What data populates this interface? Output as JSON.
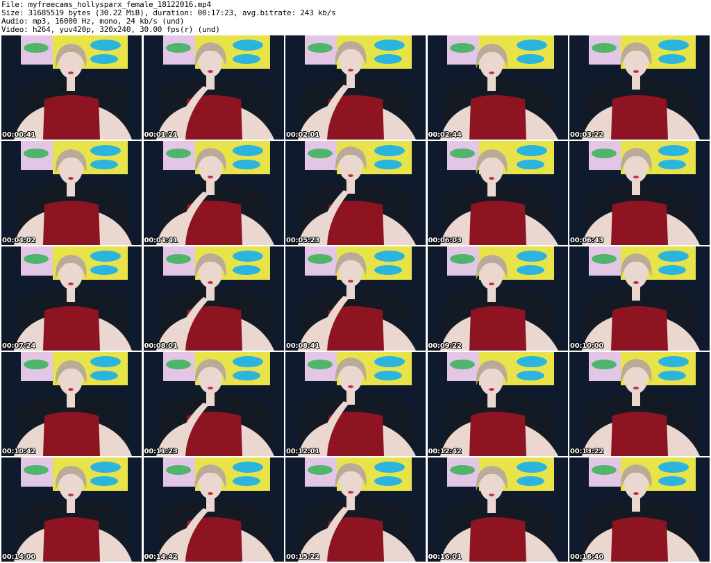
{
  "header": {
    "file_line": "File: myfreecams_hollysparx_female_18122016.mp4",
    "size_line": "Size: 31685519 bytes (30.22 MiB), duration: 00:17:23, avg.bitrate: 243 kb/s",
    "audio_line": "Audio: mp3, 16000 Hz, mono, 24 kb/s (und)",
    "video_line": "Video: h264, yuv420p, 320x240, 30.00 fps(r) (und)"
  },
  "thumbnails": [
    {
      "timestamp": "00:00:41"
    },
    {
      "timestamp": "00:01:21"
    },
    {
      "timestamp": "00:02:01"
    },
    {
      "timestamp": "00:02:44"
    },
    {
      "timestamp": "00:03:22"
    },
    {
      "timestamp": "00:04:02"
    },
    {
      "timestamp": "00:04:41"
    },
    {
      "timestamp": "00:05:23"
    },
    {
      "timestamp": "00:06:03"
    },
    {
      "timestamp": "00:06:43"
    },
    {
      "timestamp": "00:07:24"
    },
    {
      "timestamp": "00:08:01"
    },
    {
      "timestamp": "00:08:41"
    },
    {
      "timestamp": "00:09:22"
    },
    {
      "timestamp": "00:10:00"
    },
    {
      "timestamp": "00:10:42"
    },
    {
      "timestamp": "00:11:23"
    },
    {
      "timestamp": "00:12:01"
    },
    {
      "timestamp": "00:12:42"
    },
    {
      "timestamp": "00:13:22"
    },
    {
      "timestamp": "00:14:00"
    },
    {
      "timestamp": "00:14:42"
    },
    {
      "timestamp": "00:15:22"
    },
    {
      "timestamp": "00:16:01"
    },
    {
      "timestamp": "00:16:40"
    }
  ],
  "colors": {
    "background": "#ffffff",
    "wall": "#0f1a2c",
    "poster_pink": "#e3c6e6",
    "poster_yellow": "#e9e34a",
    "lips_blue": "#2ab4de",
    "lips_green": "#4fb56a",
    "top_red": "#8e1422",
    "skin": "#ead7cf",
    "hair": "#b9ab98",
    "chair": "#141a24"
  }
}
